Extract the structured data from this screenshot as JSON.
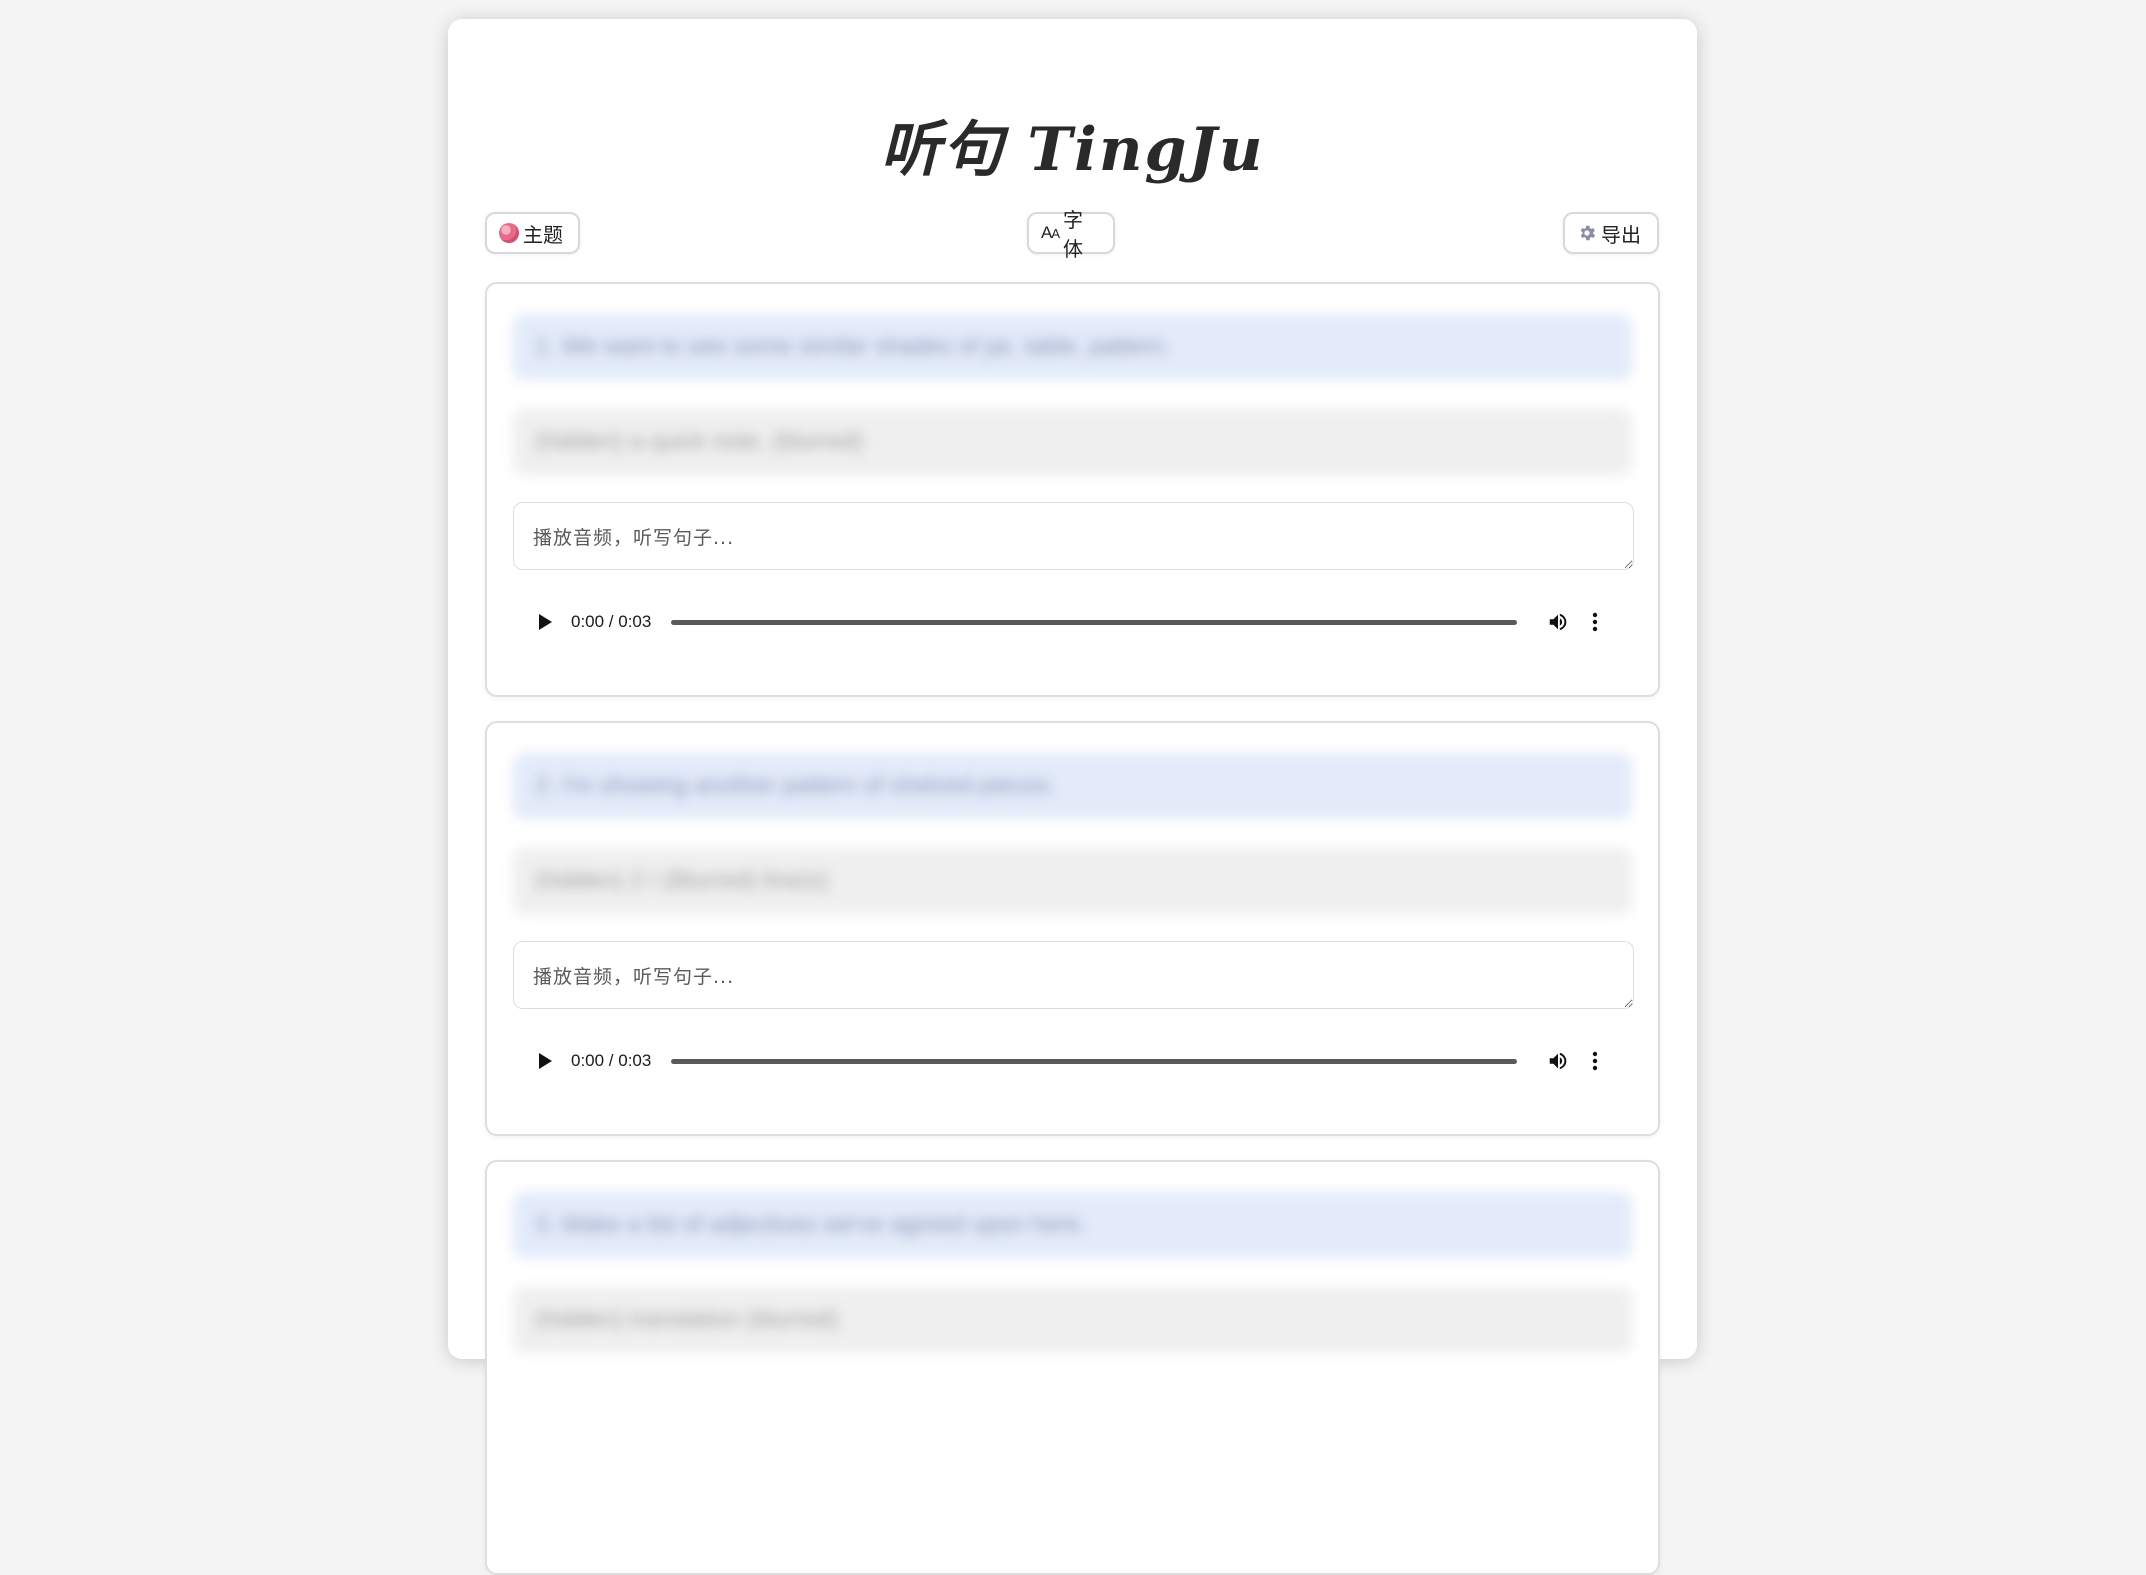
{
  "app": {
    "title": "听句 TingJu"
  },
  "toolbar": {
    "theme_label": "主题",
    "font_label": "字体",
    "font_icon_text": "AA",
    "export_label": "导出"
  },
  "cards": [
    {
      "sentence": "1. We want to see some similar shades of jar, table, pattern.",
      "translation": "(hidden) a quick note, (blurred)",
      "placeholder": "播放音频，听写句子...",
      "time": "0:00 / 0:03",
      "progress": 0
    },
    {
      "sentence": "2. I'm showing another pattern of shelved pieces.",
      "translation": "(hidden) 2 I (Blurred) line(s)",
      "placeholder": "播放音频，听写句子...",
      "time": "0:00 / 0:03",
      "progress": 0
    },
    {
      "sentence": "3. Make a list of adjectives we've agreed upon here.",
      "translation": "(hidden) translation (blurred)",
      "placeholder": "",
      "time": "",
      "progress": 0
    }
  ],
  "colors": {
    "background": "#f4f4f4",
    "sentence_bg": "#e3ebfa",
    "translation_bg": "#efefef",
    "border": "#dedede"
  },
  "icons": {
    "theme": "palette-icon",
    "font": "font-size-icon",
    "export": "gear-icon",
    "play": "play-icon",
    "volume": "volume-icon",
    "more": "more-vertical-icon"
  }
}
